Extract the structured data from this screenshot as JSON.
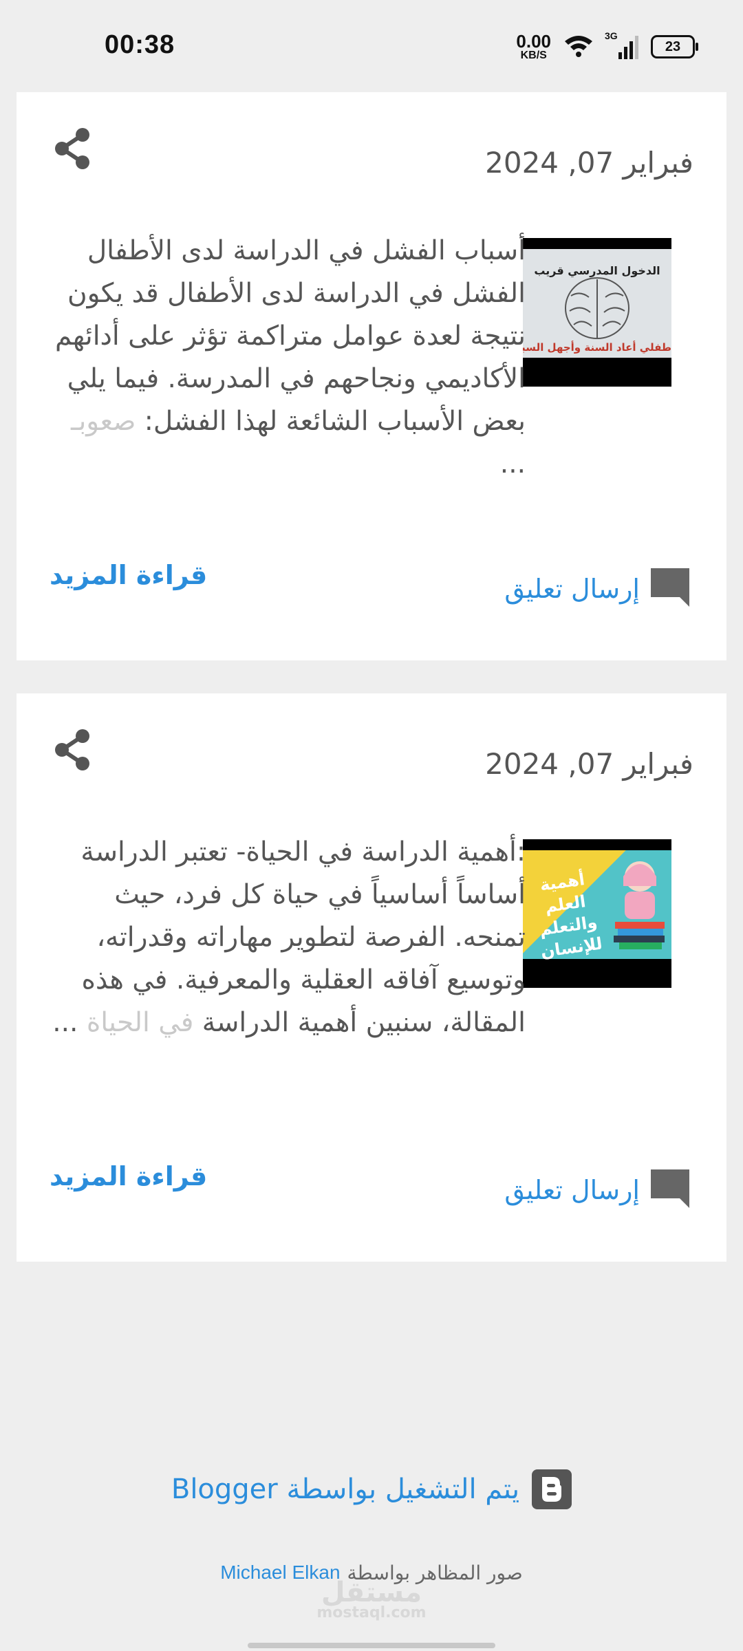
{
  "status": {
    "time": "00:38",
    "net_speed_value": "0.00",
    "net_speed_unit": "KB/S",
    "network_type": "3G",
    "battery": "23"
  },
  "posts": [
    {
      "date": "فبراير 07, 2024",
      "thumbnail": {
        "top_text": "الدخول المدرسي قريب",
        "bottom_text": "طفلي أعاد السنة وأجهل السبب"
      },
      "snippet": "أسباب الفشل في الدراسة لدى الأطفال الفشل في الدراسة لدى الأطفال قد يكون نتيجة لعدة عوامل متراكمة تؤثر على أدائهم الأكاديمي ونجاحهم في المدرسة. فيما يلي بعض الأسباب الشائعة لهذا الفشل:",
      "snippet_faded": "صعوبـ",
      "ellipsis": "...",
      "read_more": "قراءة المزيد",
      "comment": "إرسال تعليق"
    },
    {
      "date": "فبراير 07, 2024",
      "thumbnail": {
        "text": "أهمية العلم والتعلم للإنسان"
      },
      "snippet": ":أهمية الدراسة في الحياة- تعتبر الدراسة أساساً أساسياً في حياة كل فرد، حيث تمنحه. الفرصة لتطوير مهاراته وقدراته، وتوسيع آفاقه العقلية والمعرفية. في هذه المقالة، سنبين أهمية الدراسة",
      "snippet_faded": "في الحياة",
      "ellipsis": "...",
      "read_more": "قراءة المزيد",
      "comment": "إرسال تعليق"
    }
  ],
  "footer": {
    "powered_by": "يتم التشغيل بواسطة Blogger",
    "credit_prefix": "صور المظاهر بواسطة",
    "credit_author": "Michael Elkan",
    "watermark": "مستقل",
    "watermark_sub": "mostaql.com"
  },
  "colors": {
    "link": "#2b8ddb",
    "background": "#eeeeee",
    "card": "#ffffff"
  }
}
